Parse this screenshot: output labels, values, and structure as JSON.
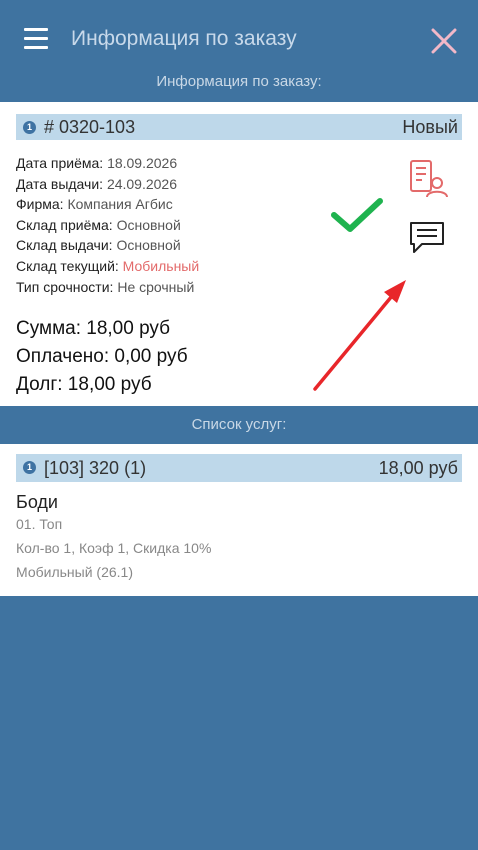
{
  "header": {
    "title": "Информация по заказу",
    "menu_icon": "menu-icon",
    "close_icon": "close-icon"
  },
  "order_section_label": "Информация по заказу:",
  "order": {
    "number": "# 0320-103",
    "status": "Новый",
    "fields": [
      {
        "label": "Дата приёма:",
        "value": "18.09.2026"
      },
      {
        "label": "Дата выдачи:",
        "value": "24.09.2026"
      },
      {
        "label": "Фирма:",
        "value": "Компания Агбис"
      },
      {
        "label": "Склад приёма:",
        "value": "Основной"
      },
      {
        "label": "Склад выдачи:",
        "value": "Основной"
      },
      {
        "label": "Склад текущий:",
        "value": "Мобильный"
      },
      {
        "label": "Тип срочности:",
        "value": "Не срочный"
      }
    ],
    "totals": {
      "sum": "Сумма: 18,00 руб",
      "paid": "Оплачено: 0,00 руб",
      "debt": "Долг: 18,00 руб"
    },
    "actions": [
      "document-person-icon",
      "message-icon"
    ]
  },
  "services_section_label": "Список услуг:",
  "services": [
    {
      "code": "[103] 320 (1)",
      "price": "18,00 руб",
      "name": "Боди",
      "line1": "01. Топ",
      "line2": "Кол-во 1, Коэф 1, Скидка 10%",
      "line3": "Мобильный (26.1)"
    }
  ],
  "colors": {
    "primary": "#3f73a0",
    "header_strip": "#bed8ea",
    "accent_red": "#e36a6a",
    "check_green": "#1fb34f",
    "arrow_red": "#e8262a"
  }
}
